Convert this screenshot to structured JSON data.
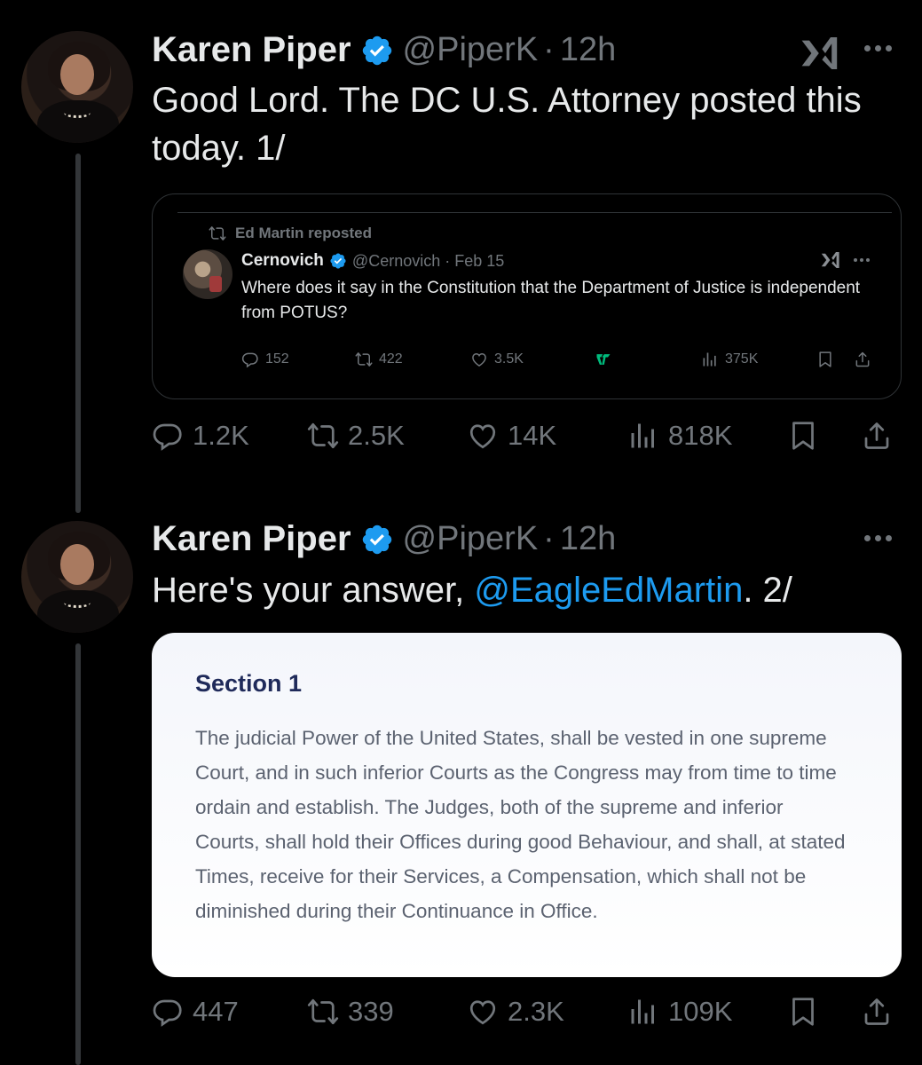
{
  "tweets": [
    {
      "author_name": "Karen Piper",
      "handle": "@PiperK",
      "separator": "·",
      "time": "12h",
      "text": "Good Lord. The DC U.S. Attorney posted this today. 1/",
      "quote": {
        "reposted_by": "Ed Martin reposted",
        "author_name": "Cernovich",
        "handle": "@Cernovich",
        "separator": "·",
        "time": "Feb 15",
        "text": "Where does it say in the Constitution that the Department of Justice is independent from POTUS?",
        "replies": "152",
        "reposts": "422",
        "likes": "3.5K",
        "views": "375K"
      },
      "replies": "1.2K",
      "reposts": "2.5K",
      "likes": "14K",
      "views": "818K"
    },
    {
      "author_name": "Karen Piper",
      "handle": "@PiperK",
      "separator": "·",
      "time": "12h",
      "text_before": "Here's your answer, ",
      "mention": "@EagleEdMartin",
      "text_after": ". 2/",
      "document": {
        "title": "Section 1",
        "body": "The judicial Power of the United States, shall be vested in one supreme Court, and in such inferior Courts as the Congress may from time to time ordain and establish. The Judges, both of the supreme and inferior Courts, shall hold their Offices during good Behaviour, and shall, at stated Times, receive for their Services, a Compensation, which shall not be diminished during their Continuance in Office."
      },
      "replies": "447",
      "reposts": "339",
      "likes": "2.3K",
      "views": "109K"
    }
  ],
  "colors": {
    "background": "#000000",
    "text": "#e7e9ea",
    "muted": "#71767b",
    "link": "#1d9bf0",
    "verified": "#1d9bf0",
    "grok_accent": "#00ba7c"
  },
  "icons": [
    "verified-badge-icon",
    "grok-icon",
    "more-icon",
    "reply-icon",
    "repost-icon",
    "like-icon",
    "views-icon",
    "bookmark-icon",
    "share-icon",
    "tipjar-icon"
  ]
}
